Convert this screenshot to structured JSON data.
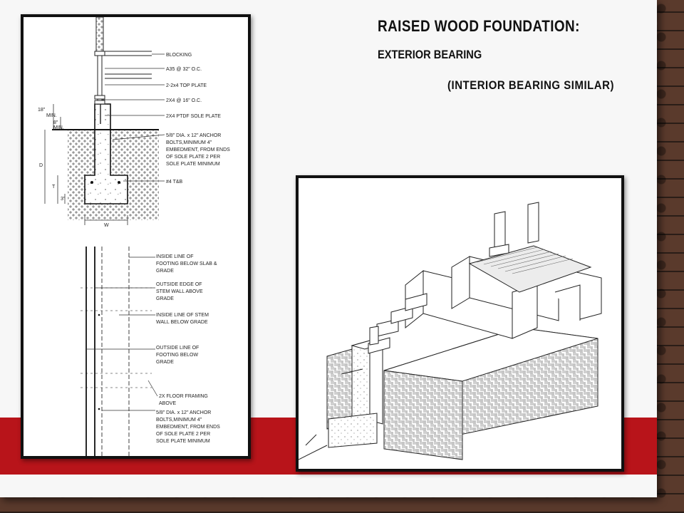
{
  "slide": {
    "title": "RAISED WOOD FOUNDATION:",
    "subtitle": "EXTERIOR BEARING",
    "note": "(INTERIOR BEARING SIMILAR)"
  },
  "section_detail": {
    "callouts": [
      "BLOCKING",
      "A35 @ 32\" O.C.",
      "2-2x4 TOP PLATE",
      "2X4 @ 16\" O.C.",
      "2X4 PTDF SOLE PLATE",
      "5/8\" DIA. x 12\" ANCHOR",
      "BOLTS,MINIMUM 4\"",
      "EMBEDMENT, FROM ENDS",
      "OF SOLE PLATE 2 PER",
      "SOLE PLATE MINIMUM",
      "#4 T&B"
    ],
    "dimensions": [
      "18\"",
      "MIN.",
      "8\"",
      "MIN.",
      "D",
      "T",
      "3\"",
      "W"
    ]
  },
  "plan_detail": {
    "callouts": [
      "INSIDE LINE OF",
      "FOOTING BELOW SLAB &",
      "GRADE",
      "OUTSIDE EDGE OF",
      "STEM WALL ABOVE",
      "GRADE",
      "INSIDE LINE OF STEM",
      "WALL BELOW GRADE",
      "OUTSIDE LINE OF",
      "FOOTING BELOW",
      "GRADE",
      "2X FLOOR FRAMING",
      "ABOVE",
      "5/8\" DIA. x 12\" ANCHOR",
      "BOLTS,MINIMUM 4\"",
      "EMBEDMENT, FROM ENDS",
      "OF SOLE PLATE 2 PER",
      "SOLE PLATE MINIMUM"
    ]
  },
  "colors": {
    "accent_band": "#b8141a",
    "slide_bg": "#f7f7f7",
    "frame_border": "#111111"
  }
}
